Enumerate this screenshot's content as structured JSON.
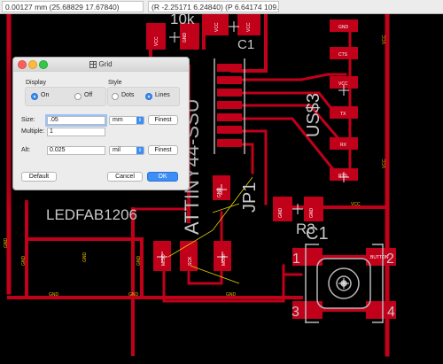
{
  "status": {
    "coord_mm": "0.00127 mm (25.68829 17.67840)",
    "coord_polar": "(R -2.25171 6.24840) (P 6.64174 109.81743°)"
  },
  "colors": {
    "background": "#000000",
    "copper": "#c1001a",
    "silk": "#b8b8b8",
    "pin_label": "#f0c000",
    "dialog_accent": "#3b8ef5"
  },
  "board": {
    "silk_labels": [
      "10k",
      "C1",
      "ATTINY44-SSU",
      "US$3",
      "JP1",
      "LEDFAB1206",
      "R3",
      "C1",
      "1",
      "2",
      "3",
      "4"
    ],
    "pad_labels": [
      "GND",
      "VCC",
      "CTS",
      "VCC",
      "TX",
      "RX",
      "RTS",
      "MISO",
      "SCK",
      "MOSI",
      "GND",
      "VCC",
      "BUTTON",
      "GND",
      "GND",
      "GND",
      "VCC"
    ],
    "net_labels": [
      "GND",
      "GND",
      "GND",
      "GND",
      "GND",
      "GND",
      "GND",
      "VCC",
      "VCC",
      "VCC"
    ]
  },
  "dialog": {
    "title": "Grid",
    "title_icon": "grid-icon",
    "display_label": "Display",
    "display_on": "On",
    "display_off": "Off",
    "style_label": "Style",
    "style_dots": "Dots",
    "style_lines": "Lines",
    "size_label": "Size:",
    "size_value": ".05",
    "size_unit": "mm",
    "finest_1": "Finest",
    "multiple_label": "Multiple:",
    "multiple_value": "1",
    "alt_label": "Alt:",
    "alt_value": "0.025",
    "alt_unit": "mil",
    "finest_2": "Finest",
    "default_btn": "Default",
    "cancel_btn": "Cancel",
    "ok_btn": "OK",
    "display_selected": "On",
    "style_selected": "Lines"
  }
}
